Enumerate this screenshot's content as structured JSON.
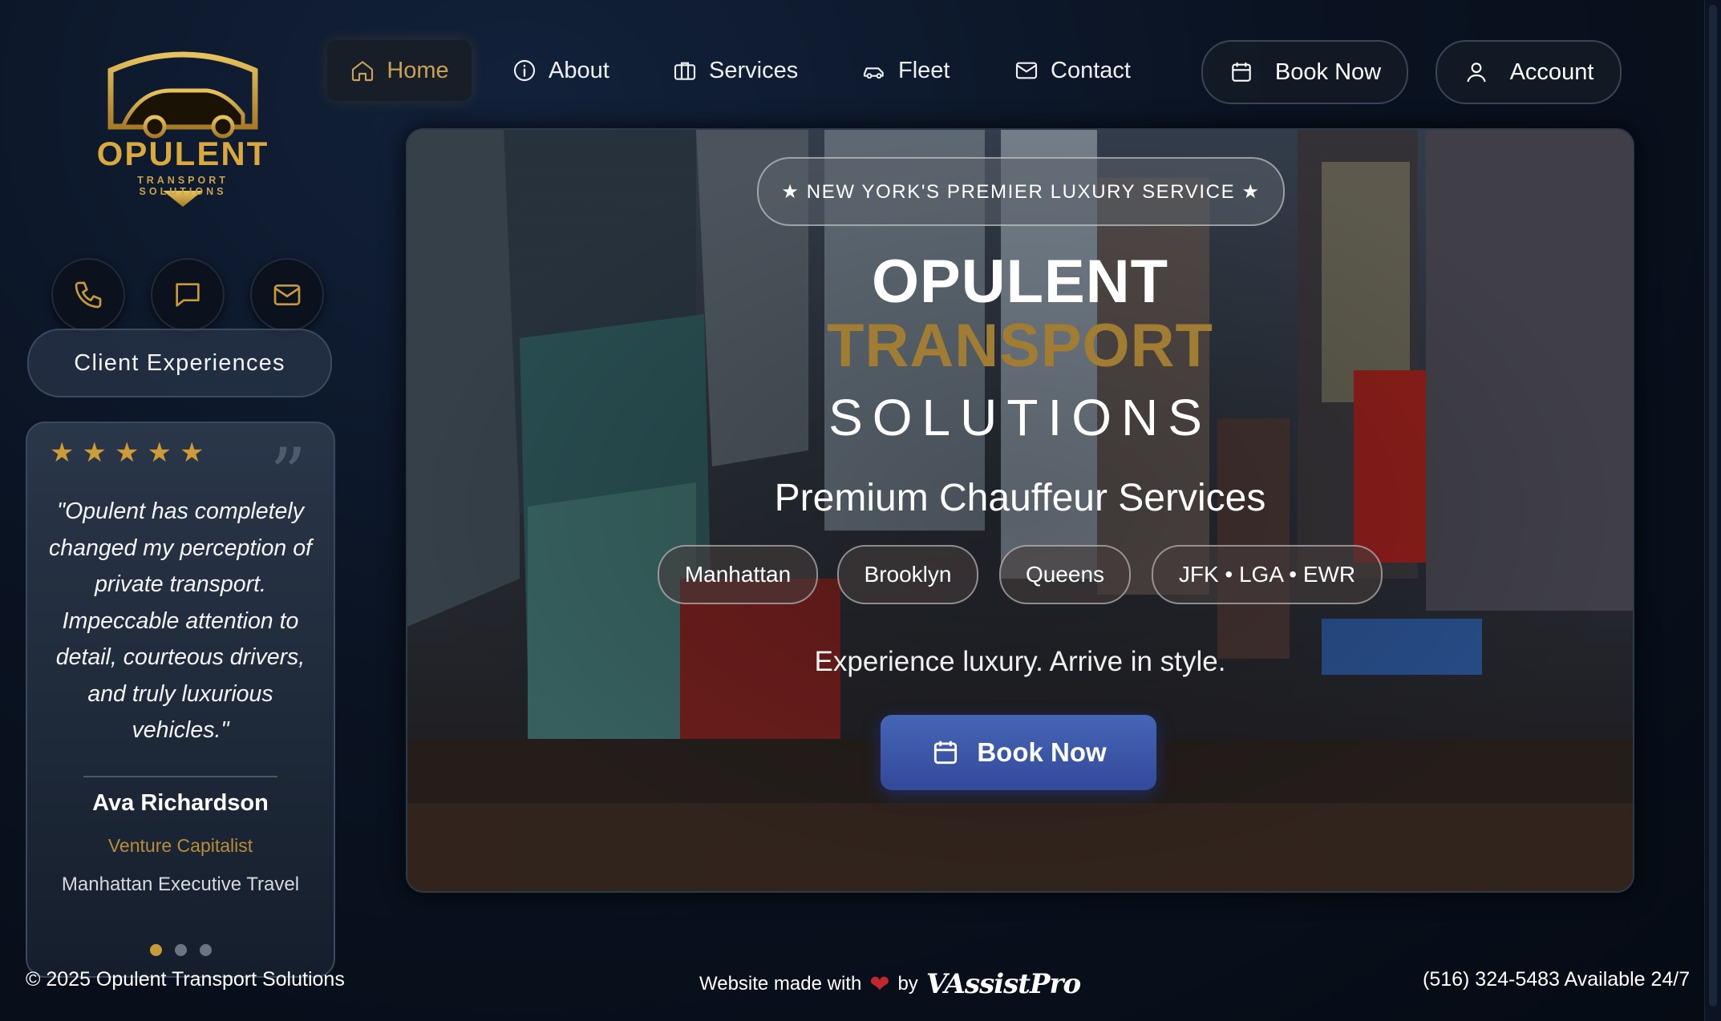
{
  "brand": {
    "logo_name": "OPULENT",
    "logo_tagline": "TRANSPORT SOLUTIONS"
  },
  "nav": {
    "items": [
      {
        "label": "Home",
        "icon": "home-icon",
        "active": true
      },
      {
        "label": "About",
        "icon": "info-icon"
      },
      {
        "label": "Services",
        "icon": "briefcase-icon"
      },
      {
        "label": "Fleet",
        "icon": "car-icon"
      },
      {
        "label": "Contact",
        "icon": "mail-icon"
      }
    ],
    "book_now": "Book Now",
    "account": "Account"
  },
  "sidebar": {
    "contact_icons": [
      "phone-icon",
      "chat-icon",
      "mail-icon"
    ],
    "client_experiences": "Client Experiences",
    "testimonial": {
      "rating": 5,
      "quote": "\"Opulent has completely changed my perception of private transport. Impeccable attention to detail, courteous drivers, and truly luxurious vehicles.\"",
      "name": "Ava Richardson",
      "role": "Venture Capitalist",
      "context": "Manhattan Executive Travel",
      "slide_count": 3,
      "active_slide": 1
    }
  },
  "hero": {
    "badge": "★ NEW YORK'S PREMIER LUXURY SERVICE ★",
    "title_line1": "OPULENT",
    "title_line2": "TRANSPORT",
    "title_line3": "SOLUTIONS",
    "subtitle": "Premium Chauffeur Services",
    "locations": [
      "Manhattan",
      "Brooklyn",
      "Queens",
      "JFK • LGA • EWR"
    ],
    "tagline": "Experience luxury. Arrive in style.",
    "cta": "Book Now"
  },
  "footer": {
    "copyright": "© 2025 Opulent Transport Solutions",
    "made_with": "Website made with",
    "by": "by",
    "vendor": "VAssistPro",
    "phone": "(516) 324-5483 Available 24/7"
  },
  "colors": {
    "gold": "#c89a3a",
    "accent_blue": "#3f5db0",
    "background": "#0a1322"
  }
}
